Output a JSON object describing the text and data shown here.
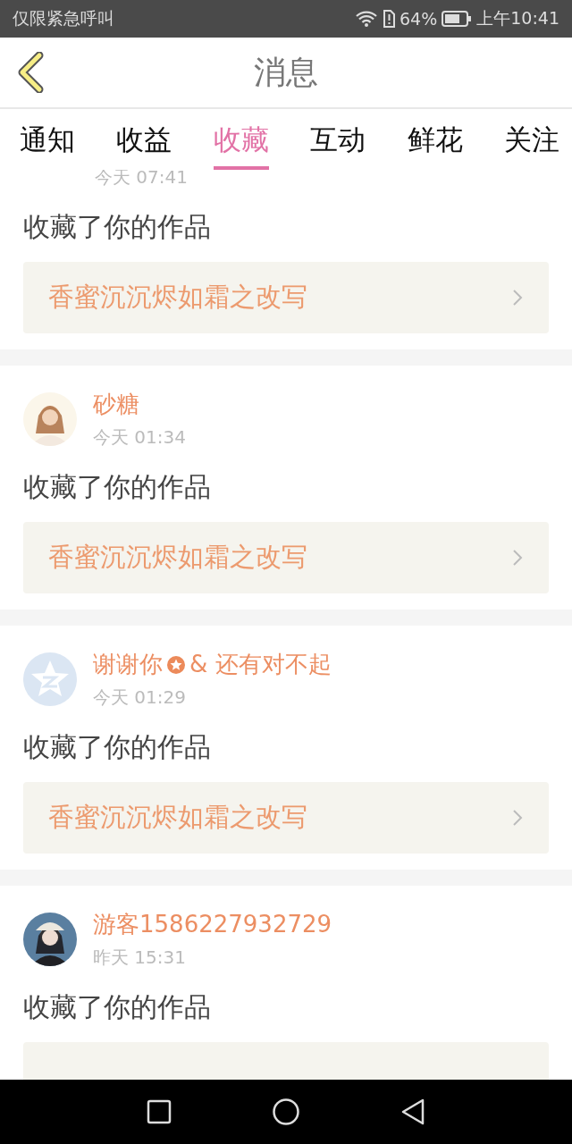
{
  "status_bar": {
    "carrier": "仅限紧急呼叫",
    "battery": "64%",
    "time": "上午10:41"
  },
  "header": {
    "title": "消息"
  },
  "tabs": [
    {
      "label": "通知",
      "selected": false
    },
    {
      "label": "收益",
      "selected": false
    },
    {
      "label": "收藏",
      "selected": true
    },
    {
      "label": "互动",
      "selected": false
    },
    {
      "label": "鲜花",
      "selected": false
    },
    {
      "label": "关注",
      "selected": false
    }
  ],
  "messages": [
    {
      "time": "今天 07:41",
      "action": "收藏了你的作品",
      "work": "香蜜沉沉烬如霜之改写"
    },
    {
      "name": "砂糖",
      "time": "今天 01:34",
      "action": "收藏了你的作品",
      "work": "香蜜沉沉烬如霜之改写"
    },
    {
      "kind": "default",
      "name": "谢谢你",
      "badge": true,
      "name_rest": "& 还有对不起",
      "time": "今天 01:29",
      "action": "收藏了你的作品",
      "work": "香蜜沉沉烬如霜之改写"
    },
    {
      "name": "游客1586227932729",
      "time": "昨天 15:31",
      "action": "收藏了你的作品"
    }
  ]
}
